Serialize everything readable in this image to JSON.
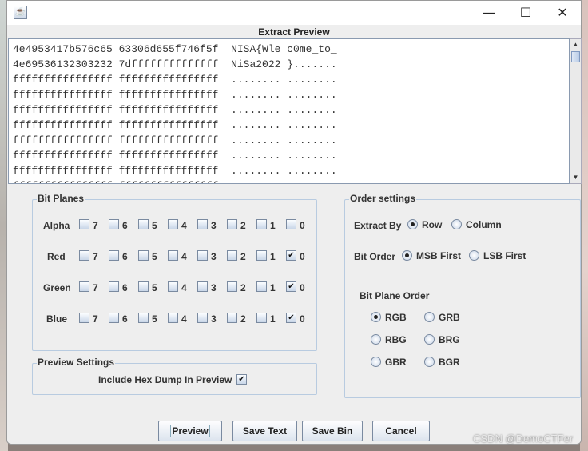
{
  "window": {
    "title": "",
    "heading": "Extract Preview",
    "controls": {
      "minimize": "—",
      "maximize": "☐",
      "close": "✕"
    }
  },
  "preview": {
    "lines": [
      "4e4953417b576c65 63306d655f746f5f  NISA{Wle c0me_to_",
      "4e69536132303232 7dffffffffffffff  NiSa2022 }.......",
      "ffffffffffffffff ffffffffffffffff  ........ ........",
      "ffffffffffffffff ffffffffffffffff  ........ ........",
      "ffffffffffffffff ffffffffffffffff  ........ ........",
      "ffffffffffffffff ffffffffffffffff  ........ ........",
      "ffffffffffffffff ffffffffffffffff  ........ ........",
      "ffffffffffffffff ffffffffffffffff  ........ ........",
      "ffffffffffffffff ffffffffffffffff  ........ ........",
      "ffffffffffffffff ffffffffffffffff  ........ ........",
      "ffffffffffffffff ffffffffffffffff  ........ ........"
    ]
  },
  "bit_planes": {
    "title": "Bit Planes",
    "bits": [
      "7",
      "6",
      "5",
      "4",
      "3",
      "2",
      "1",
      "0"
    ],
    "rows": [
      {
        "label": "Alpha",
        "checked": [
          false,
          false,
          false,
          false,
          false,
          false,
          false,
          false
        ]
      },
      {
        "label": "Red",
        "checked": [
          false,
          false,
          false,
          false,
          false,
          false,
          false,
          true
        ]
      },
      {
        "label": "Green",
        "checked": [
          false,
          false,
          false,
          false,
          false,
          false,
          false,
          true
        ]
      },
      {
        "label": "Blue",
        "checked": [
          false,
          false,
          false,
          false,
          false,
          false,
          false,
          true
        ]
      }
    ]
  },
  "preview_settings": {
    "title": "Preview Settings",
    "hex_dump_label": "Include Hex Dump In Preview",
    "hex_dump_checked": true
  },
  "order_settings": {
    "title": "Order settings",
    "extract_by": {
      "label": "Extract By",
      "options": [
        "Row",
        "Column"
      ],
      "selected": "Row"
    },
    "bit_order": {
      "label": "Bit Order",
      "options": [
        "MSB First",
        "LSB First"
      ],
      "selected": "MSB First"
    },
    "bit_plane_order": {
      "label": "Bit Plane Order",
      "options": [
        "RGB",
        "GRB",
        "RBG",
        "BRG",
        "GBR",
        "BGR"
      ],
      "selected": "RGB"
    }
  },
  "buttons": {
    "preview": "Preview",
    "save_text": "Save Text",
    "save_bin": "Save Bin",
    "cancel": "Cancel"
  },
  "watermark": "CSDN @DemoCTFer",
  "check_glyph": "✔"
}
